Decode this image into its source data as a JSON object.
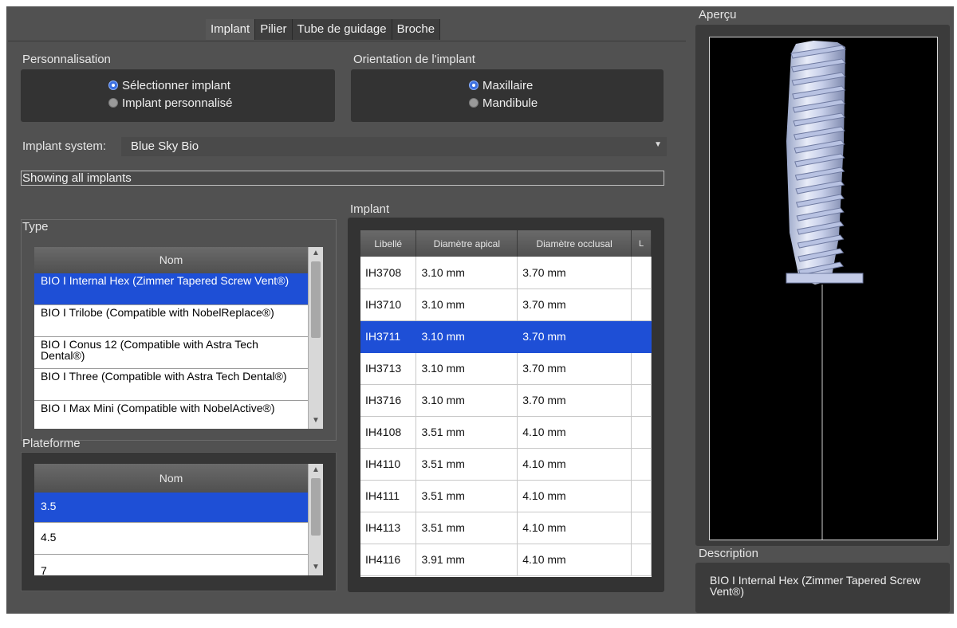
{
  "tabs": [
    "Implant",
    "Pilier",
    "Tube de guidage",
    "Broche"
  ],
  "personalisation": {
    "title": "Personnalisation",
    "options": [
      "Sélectionner implant",
      "Implant personnalisé"
    ]
  },
  "orientation": {
    "title": "Orientation de l'implant",
    "options": [
      "Maxillaire",
      "Mandibule"
    ]
  },
  "implant_system": {
    "label": "Implant system:",
    "value": "Blue Sky Bio"
  },
  "filter_text": "Showing all implants",
  "type": {
    "title": "Type",
    "header": "Nom",
    "items": [
      "BIO I Internal Hex (Zimmer Tapered Screw Vent®)",
      "BIO I Trilobe (Compatible with NobelReplace®)",
      "BIO I Conus 12 (Compatible with Astra Tech Dental®)",
      "BIO I Three (Compatible with Astra Tech Dental®)",
      "BIO I Max Mini (Compatible with NobelActive®)"
    ]
  },
  "plateforme": {
    "title": "Plateforme",
    "header": "Nom",
    "items": [
      "3.5",
      "4.5",
      "7"
    ]
  },
  "implant_table": {
    "title": "Implant",
    "columns": [
      "Libellé",
      "Diamètre apical",
      "Diamètre occlusal",
      "L"
    ],
    "rows": [
      [
        "IH3708",
        "3.10 mm",
        "3.70 mm"
      ],
      [
        "IH3710",
        "3.10 mm",
        "3.70 mm"
      ],
      [
        "IH3711",
        "3.10 mm",
        "3.70 mm"
      ],
      [
        "IH3713",
        "3.10 mm",
        "3.70 mm"
      ],
      [
        "IH3716",
        "3.10 mm",
        "3.70 mm"
      ],
      [
        "IH4108",
        "3.51 mm",
        "4.10 mm"
      ],
      [
        "IH4110",
        "3.51 mm",
        "4.10 mm"
      ],
      [
        "IH4111",
        "3.51 mm",
        "4.10 mm"
      ],
      [
        "IH4113",
        "3.51 mm",
        "4.10 mm"
      ],
      [
        "IH4116",
        "3.91 mm",
        "4.10 mm"
      ]
    ]
  },
  "preview": {
    "title": "Aperçu"
  },
  "description": {
    "title": "Description",
    "text": "BIO I Internal Hex (Zimmer Tapered Screw Vent®)"
  },
  "colors": {
    "background": "#515151",
    "panel": "#333333",
    "selection": "#1e4fd6"
  }
}
